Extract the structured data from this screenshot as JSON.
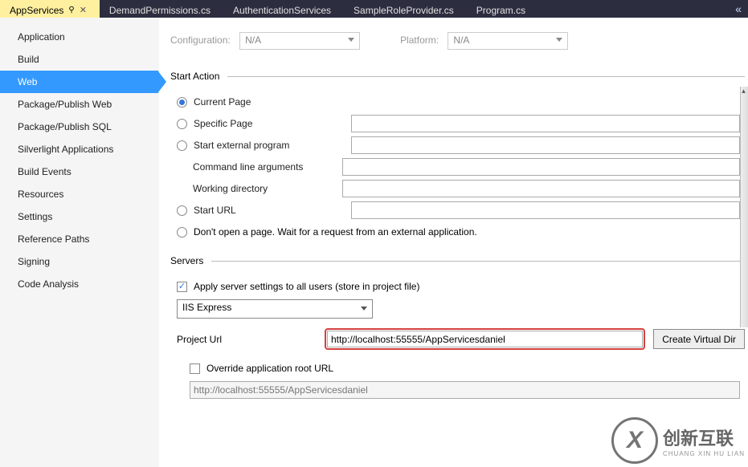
{
  "tabs": [
    {
      "label": "AppServices",
      "active": true,
      "pinned": true
    },
    {
      "label": "DemandPermissions.cs"
    },
    {
      "label": "AuthenticationServices"
    },
    {
      "label": "SampleRoleProvider.cs"
    },
    {
      "label": "Program.cs"
    }
  ],
  "sidebar": [
    "Application",
    "Build",
    "Web",
    "Package/Publish Web",
    "Package/Publish SQL",
    "Silverlight Applications",
    "Build Events",
    "Resources",
    "Settings",
    "Reference Paths",
    "Signing",
    "Code Analysis"
  ],
  "sidebar_selected": "Web",
  "top": {
    "config_label": "Configuration:",
    "config_value": "N/A",
    "platform_label": "Platform:",
    "platform_value": "N/A"
  },
  "start_action": {
    "title": "Start Action",
    "current_page": "Current Page",
    "specific_page": "Specific Page",
    "start_external": "Start external program",
    "cmd_args": "Command line arguments",
    "work_dir": "Working directory",
    "start_url": "Start URL",
    "dont_open": "Don't open a page.  Wait for a request from an external application."
  },
  "servers": {
    "title": "Servers",
    "apply_all": "Apply server settings to all users (store in project file)",
    "server_select": "IIS Express",
    "project_url_label": "Project Url",
    "project_url_value": "http://localhost:55555/AppServicesdaniel",
    "create_vdir": "Create Virtual Dir",
    "override_root": "Override application root URL",
    "root_url_value": "http://localhost:55555/AppServicesdaniel"
  },
  "watermark": {
    "brand": "创新互联",
    "sub": "CHUANG XIN HU LIAN"
  }
}
